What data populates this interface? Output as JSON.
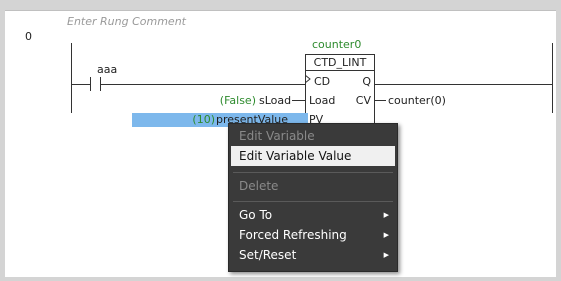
{
  "rung": {
    "number": "0",
    "comment_placeholder": "Enter Rung Comment"
  },
  "contact": {
    "variable": "aaa"
  },
  "function_block": {
    "instance": "counter0",
    "type": "CTD_LINT",
    "pins": {
      "cd": "CD",
      "q": "Q",
      "load": "Load",
      "cv": "CV",
      "pv": "PV"
    },
    "inputs": {
      "load_value": "(False)",
      "load_var": "sLoad",
      "pv_value": "(10)",
      "pv_var": "presentValue"
    },
    "outputs": {
      "cv_var": "counter(0)"
    }
  },
  "context_menu": {
    "items": [
      {
        "label": "Edit Variable",
        "state": "disabled"
      },
      {
        "label": "Edit Variable Value",
        "state": "highlighted"
      },
      {
        "label": "Delete",
        "state": "disabled"
      },
      {
        "label": "Go To",
        "state": "submenu"
      },
      {
        "label": "Forced Refreshing",
        "state": "submenu"
      },
      {
        "label": "Set/Reset",
        "state": "submenu"
      }
    ],
    "submenu_arrow": "right-triangle"
  },
  "colors": {
    "variable_value": "#2e8b2e",
    "selection": "#7db8ec",
    "menu_bg": "#3a3a3a"
  }
}
